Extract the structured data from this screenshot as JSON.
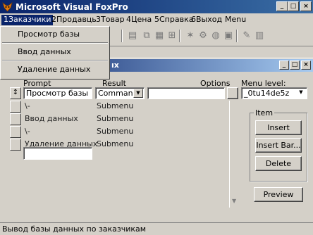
{
  "window": {
    "title": "Microsoft Visual FoxPro"
  },
  "menubar": {
    "items": [
      {
        "label": "1Заказчики"
      },
      {
        "label": "2Продавць"
      },
      {
        "label": "3Товар"
      },
      {
        "label": "4Цена"
      },
      {
        "label": "5Справка"
      },
      {
        "label": "6Выход"
      },
      {
        "label": "Menu"
      }
    ]
  },
  "dropdown": {
    "items": [
      {
        "label": "Просмотр базы"
      },
      {
        "label": "Ввод данных"
      },
      {
        "label": "Удаление данных"
      }
    ]
  },
  "builder": {
    "title_fragment": "ıx",
    "headers": {
      "prompt": "Prompt",
      "result": "Result",
      "options": "Options",
      "menu_level": "Menu level:"
    },
    "rows": [
      {
        "prompt": "Просмотр базы",
        "result": "Command"
      },
      {
        "prompt": "\\-",
        "result": "Submenu"
      },
      {
        "prompt": "Ввод данных",
        "result": "Submenu"
      },
      {
        "prompt": "\\-",
        "result": "Submenu"
      },
      {
        "prompt": "Удаление данных",
        "result": "Submenu"
      }
    ],
    "menu_level_value": "_0tu14de5z",
    "item_group": {
      "label": "Item",
      "insert": "Insert",
      "insert_bar": "Insert Bar...",
      "delete": "Delete"
    },
    "preview": "Preview"
  },
  "statusbar": {
    "text": "Вывод базы данных по заказчикам"
  },
  "colors": {
    "title_start": "#0a246a",
    "title_end": "#3a6ea5",
    "face": "#d4d0c8",
    "highlight": "#0a246a"
  }
}
